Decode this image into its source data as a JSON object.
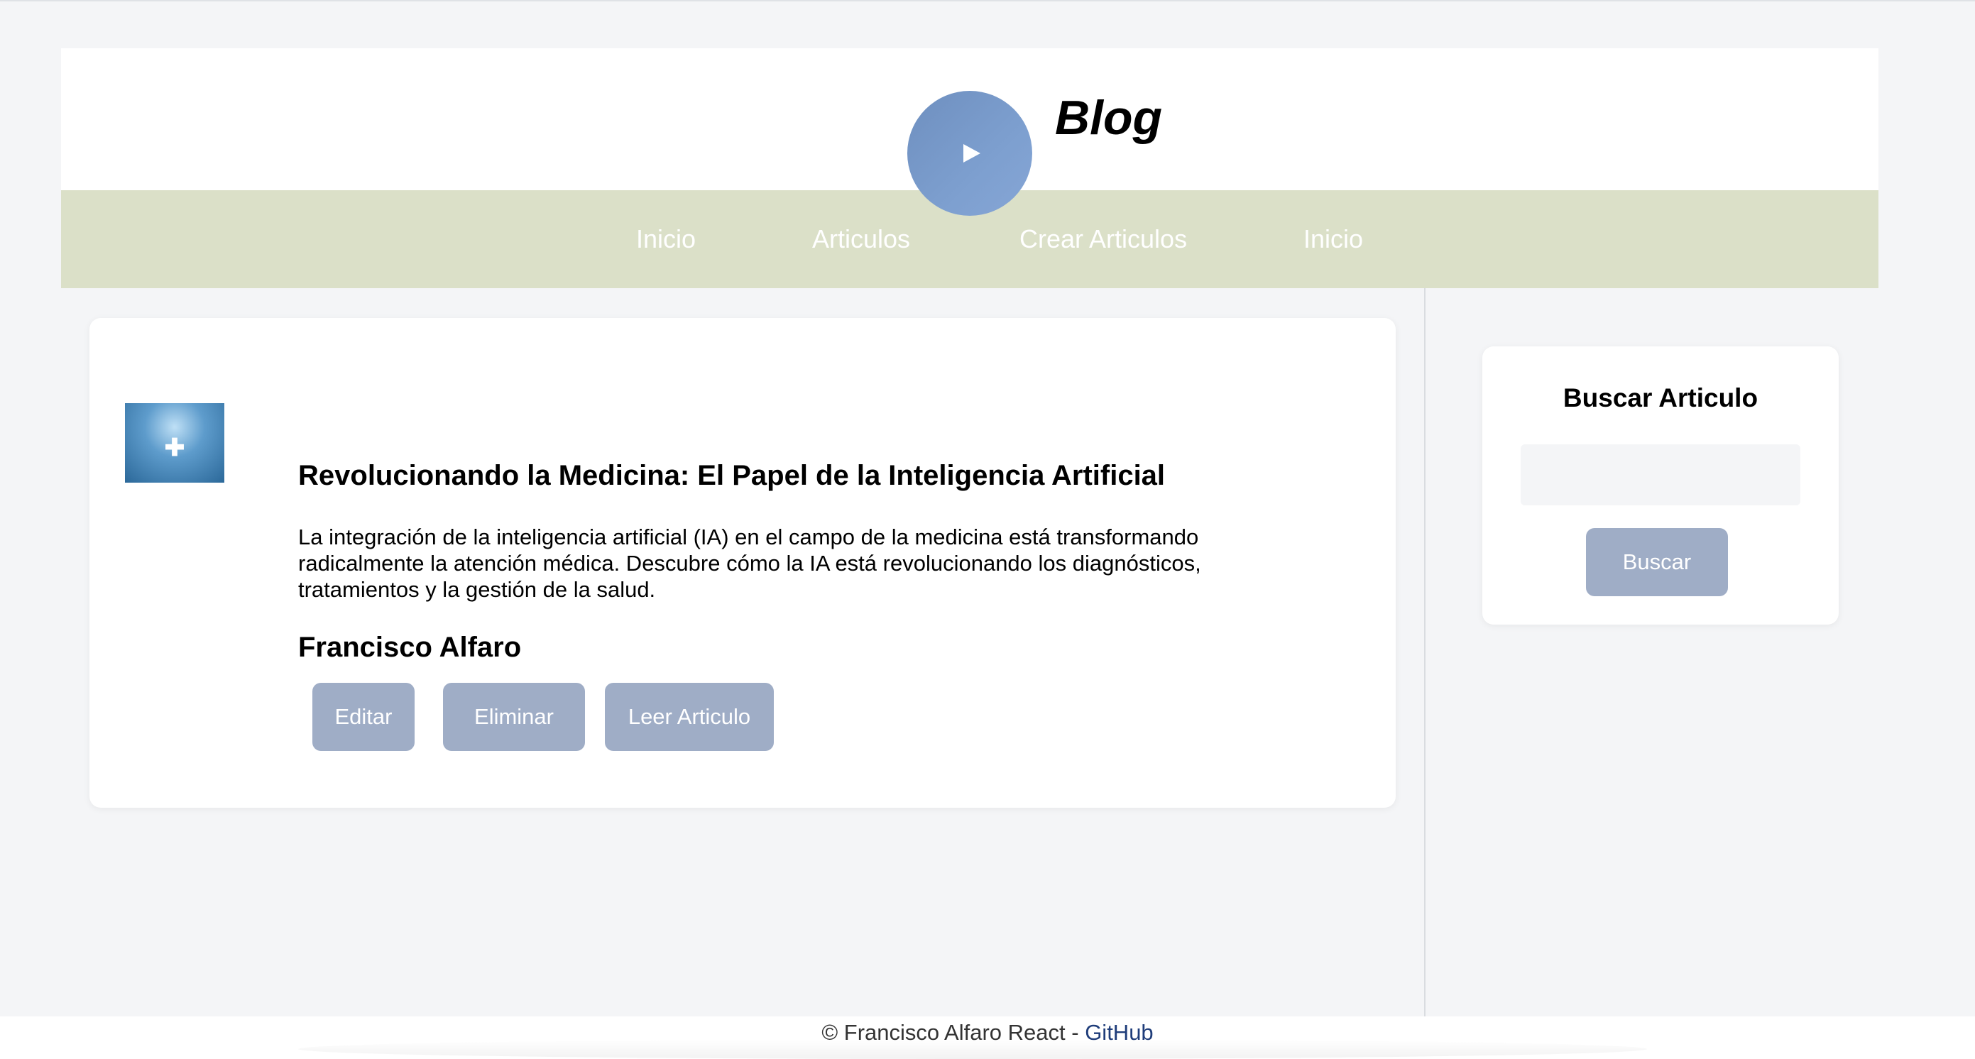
{
  "header": {
    "logo_icon": "play-icon",
    "site_title": "Blog"
  },
  "nav": {
    "items": [
      {
        "label": "Inicio"
      },
      {
        "label": "Articulos"
      },
      {
        "label": "Crear Articulos"
      },
      {
        "label": "Inicio"
      }
    ]
  },
  "article": {
    "image_icon": "medical-ai-image",
    "title": "Revolucionando la Medicina: El Papel de la Inteligencia Artificial",
    "description": "La integración de la inteligencia artificial (IA) en el campo de la medicina está transformando radicalmente la atención médica. Descubre cómo la IA está revolucionando los diagnósticos, tratamientos y la gestión de la salud.",
    "author": "Francisco Alfaro",
    "buttons": {
      "edit": "Editar",
      "delete": "Eliminar",
      "read": "Leer Articulo"
    }
  },
  "sidebar": {
    "search_title": "Buscar Articulo",
    "search_value": "",
    "search_button": "Buscar"
  },
  "footer": {
    "text": "© Francisco Alfaro React - ",
    "link_label": "GitHub"
  },
  "colors": {
    "accent_button": "#9fadc6",
    "nav_background": "#dbe0c8",
    "logo": "#7d9fcf",
    "link": "#1f3d7a"
  }
}
